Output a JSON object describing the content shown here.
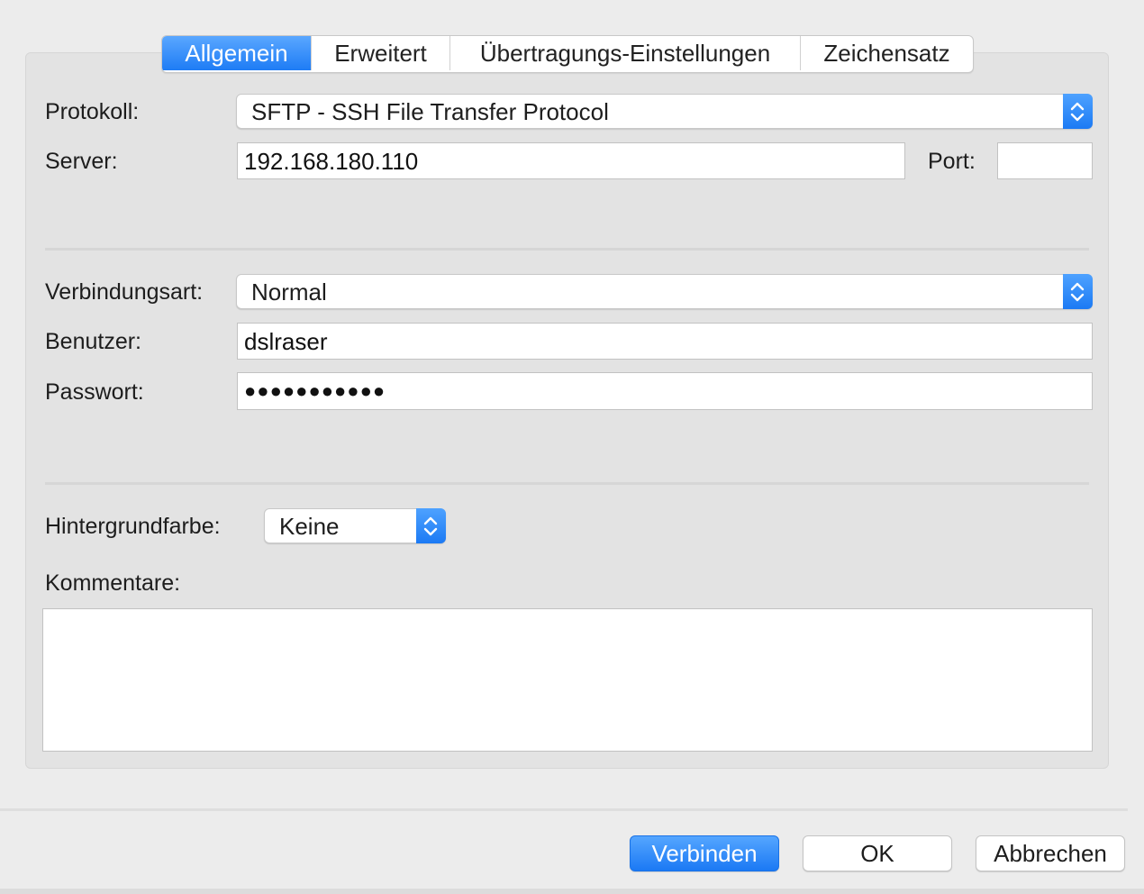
{
  "tabs": [
    {
      "label": "Allgemein",
      "active": true
    },
    {
      "label": "Erweitert",
      "active": false
    },
    {
      "label": "Übertragungs-Einstellungen",
      "active": false
    },
    {
      "label": "Zeichensatz",
      "active": false
    }
  ],
  "general": {
    "protocol_label": "Protokoll:",
    "protocol_value": "SFTP - SSH File Transfer Protocol",
    "server_label": "Server:",
    "server_value": "192.168.180.110",
    "port_label": "Port:",
    "port_value": "",
    "connection_type_label": "Verbindungsart:",
    "connection_type_value": "Normal",
    "user_label": "Benutzer:",
    "user_value": "dslraser",
    "password_label": "Passwort:",
    "password_value": "●●●●●●●●●●●",
    "bg_color_label": "Hintergrundfarbe:",
    "bg_color_value": "Keine",
    "comments_label": "Kommentare:",
    "comments_value": ""
  },
  "buttons": {
    "connect": "Verbinden",
    "ok": "OK",
    "cancel": "Abbrechen"
  },
  "colors": {
    "accent": "#1e7cf5",
    "background": "#ececec"
  },
  "icons": {
    "popup_arrows": "up-down-chevron-icon"
  }
}
